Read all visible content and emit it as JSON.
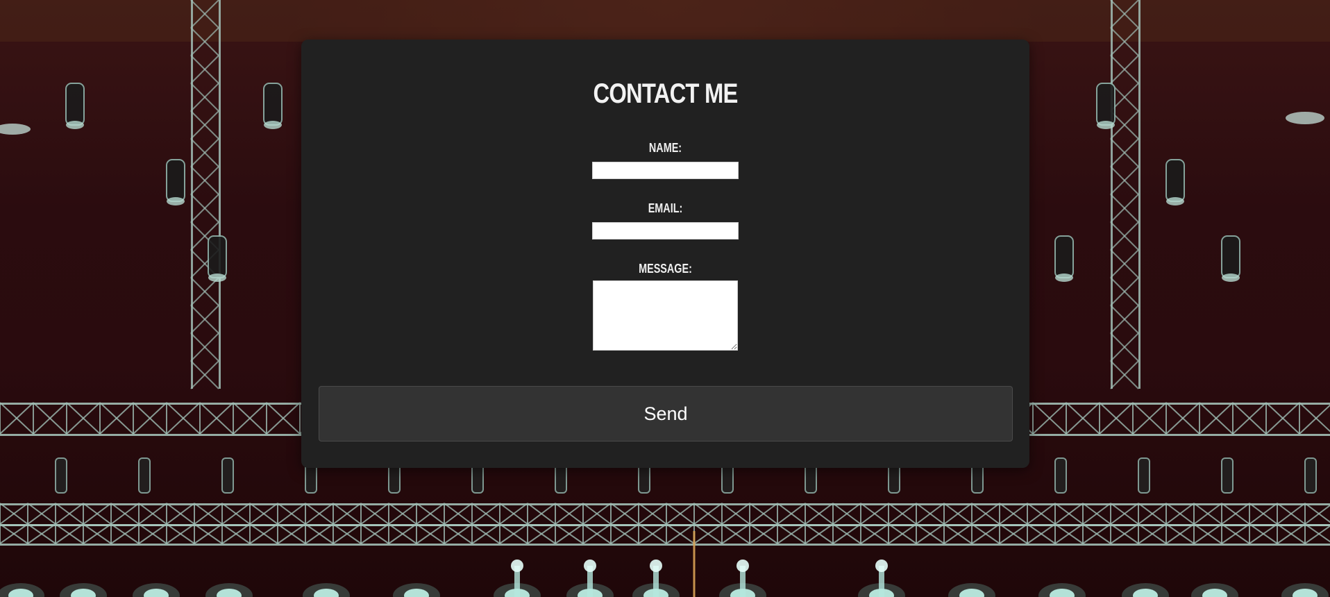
{
  "form": {
    "title": "CONTACT ME",
    "name_label": "NAME:",
    "name_value": "",
    "email_label": "EMAIL:",
    "email_value": "",
    "message_label": "MESSAGE:",
    "message_value": "",
    "send_label": "Send"
  },
  "colors": {
    "card_background": "#212121",
    "button_background": "#333333",
    "text": "#ffffff"
  }
}
